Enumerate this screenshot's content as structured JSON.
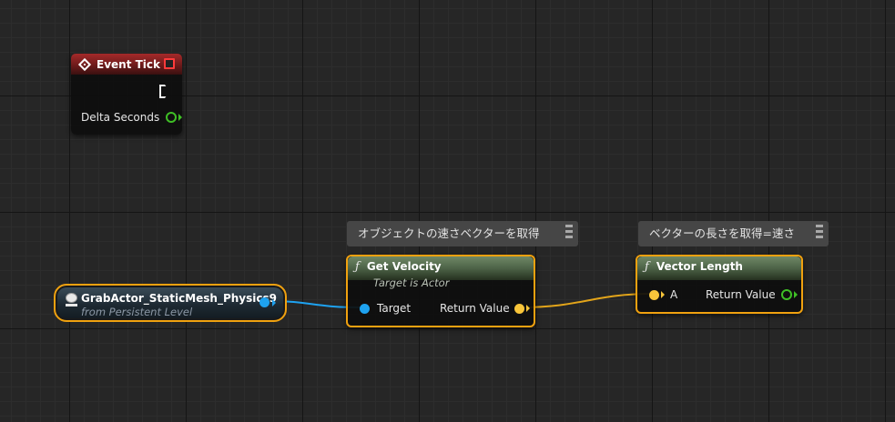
{
  "nodes": {
    "event_tick": {
      "title": "Event Tick",
      "pins": {
        "delta": "Delta Seconds"
      }
    },
    "grab_actor": {
      "title": "GrabActor_StaticMesh_Physics9",
      "subtitle": "from Persistent Level"
    },
    "get_velocity": {
      "title": "Get Velocity",
      "subtitle": "Target is Actor",
      "pin_in": "Target",
      "pin_out": "Return Value"
    },
    "vector_length": {
      "title": "Vector Length",
      "pin_in": "A",
      "pin_out": "Return Value"
    }
  },
  "comments": {
    "get_velocity": "オブジェクトの速さベクターを取得",
    "vector_length": "ベクターの長さを取得=速さ"
  },
  "colors": {
    "object_pin": "#1ea2f0",
    "vector_pin": "#f8c53a",
    "float_pin": "#3fbf26",
    "selected": "#f0a10f",
    "event_header": "#a52a2a",
    "function_header": "#5d7555"
  },
  "icons": {
    "event": "diamond-event-icon",
    "function": "function-f-icon",
    "actor": "actor-icon",
    "exec": "exec-pin-icon"
  }
}
